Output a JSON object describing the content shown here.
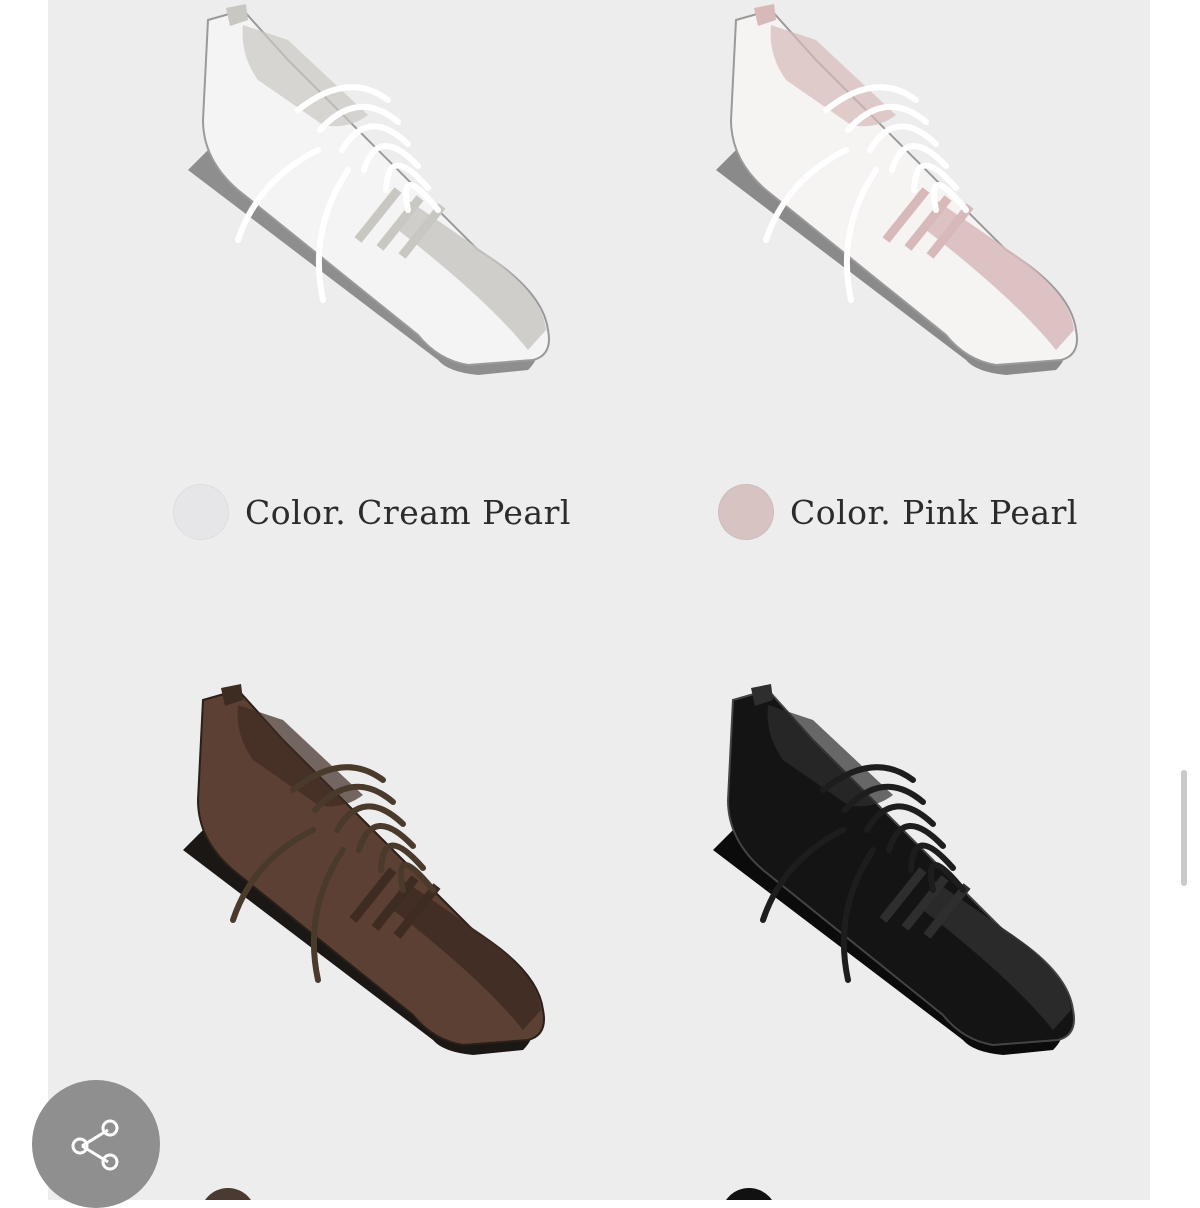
{
  "products": [
    {
      "label": "Color. Cream Pearl",
      "swatch_color": "#e6e6e8",
      "shoe_colors": {
        "upper": "#f4f4f4",
        "accent": "#c9c7c2",
        "sole": "#8e8e8e",
        "lace": "#ffffff",
        "stroke": "#9a9a9a"
      }
    },
    {
      "label": "Color. Pink Pearl",
      "swatch_color": "#d8c3c3",
      "shoe_colors": {
        "upper": "#f6f3f3",
        "accent": "#d7b9b9",
        "sole": "#8a8a8a",
        "lace": "#ffffff",
        "stroke": "#9a9a9a"
      }
    },
    {
      "label": "",
      "swatch_color": "#4a3a32",
      "shoe_colors": {
        "upper": "#5b4033",
        "accent": "#3e2b22",
        "sole": "#1b1715",
        "lace": "#4a3a2c",
        "stroke": "#2a1f19"
      }
    },
    {
      "label": "",
      "swatch_color": "#111111",
      "shoe_colors": {
        "upper": "#141414",
        "accent": "#2e2e2e",
        "sole": "#0b0b0b",
        "lace": "#1d1d1d",
        "stroke": "#444444"
      }
    }
  ],
  "share": {
    "icon": "share-icon",
    "color": "#8f8f8f"
  },
  "scrollbar": {
    "color": "#c9c9c9"
  }
}
